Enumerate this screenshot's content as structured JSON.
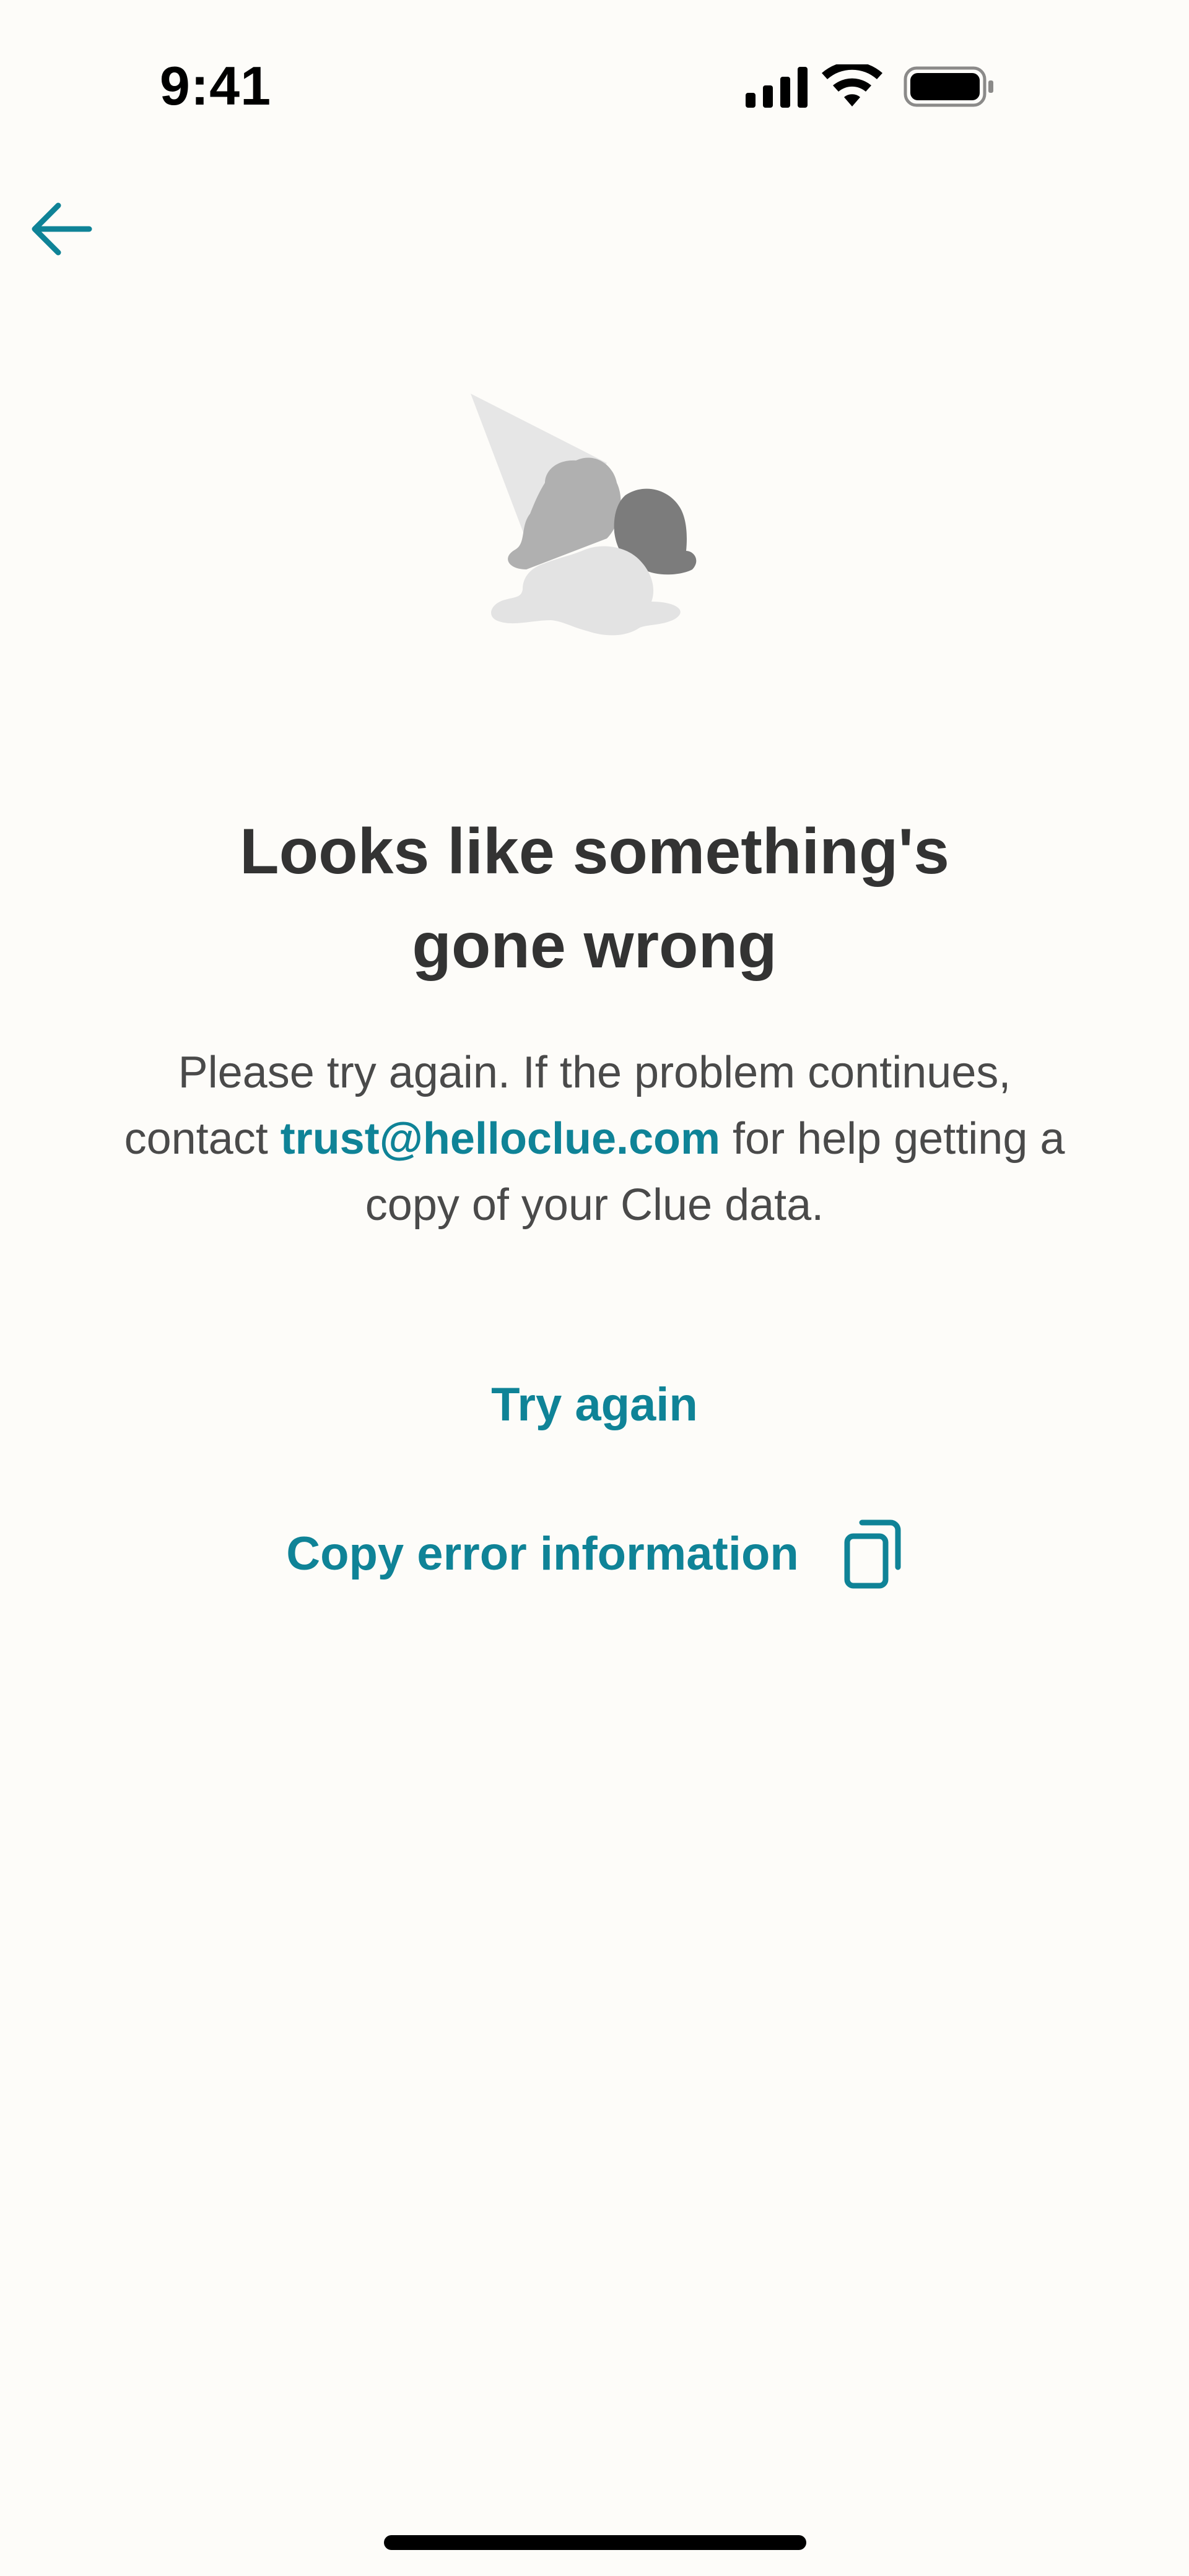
{
  "status_bar": {
    "time": "9:41",
    "icons": [
      "cellular-signal-icon",
      "wifi-icon",
      "battery-icon"
    ]
  },
  "nav": {
    "back_icon": "arrow-left-icon"
  },
  "illustration": {
    "name": "dropped-ice-cream-illustration"
  },
  "error": {
    "title_line1": "Looks like something's",
    "title_line2": "gone wrong",
    "body_line1": "Please try again. If the problem continues,",
    "body_line2_prefix": "contact ",
    "email": "trust@helloclue.com",
    "body_line2_suffix": " for help getting a",
    "body_line3": "copy of your Clue data."
  },
  "actions": {
    "try_again_label": "Try again",
    "copy_error_label": "Copy error information",
    "copy_icon": "copy-icon"
  },
  "colors": {
    "background": "#fdfcf9",
    "accent": "#0f8397",
    "title": "#333333",
    "body": "#4a4a4a"
  }
}
